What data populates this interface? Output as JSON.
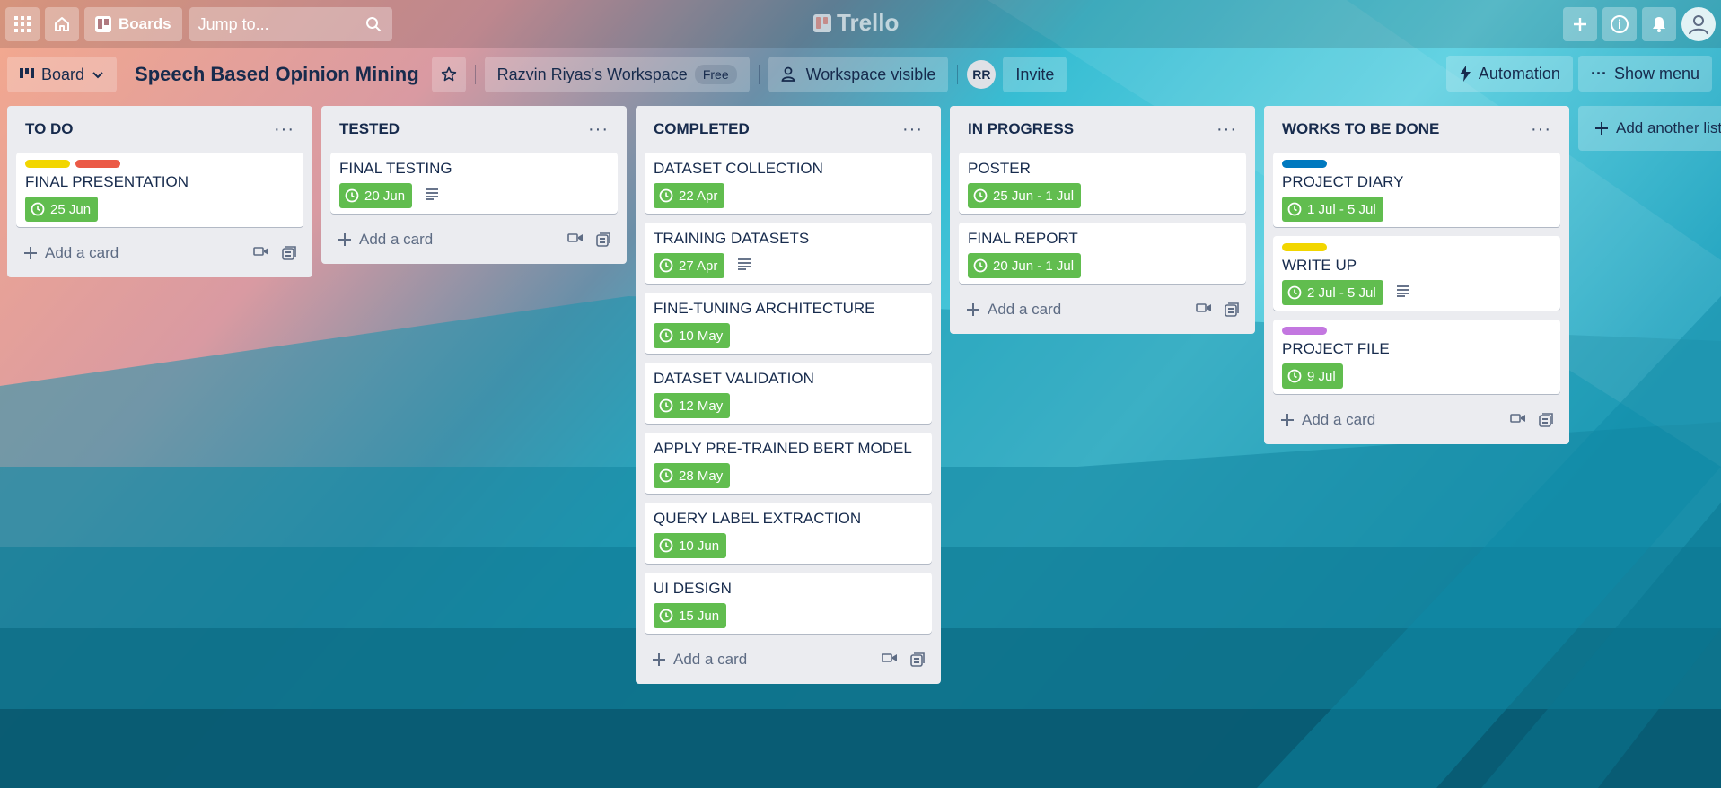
{
  "header": {
    "boards_label": "Boards",
    "search_placeholder": "Jump to...",
    "logo_text": "Trello"
  },
  "board": {
    "view_label": "Board",
    "title": "Speech Based Opinion Mining",
    "workspace_name": "Razvin Riyas's Workspace",
    "workspace_plan": "Free",
    "visibility_label": "Workspace visible",
    "member_initials": "RR",
    "invite_label": "Invite",
    "automation_label": "Automation",
    "show_menu_label": "Show menu"
  },
  "lists": [
    {
      "title": "TO DO",
      "add_label": "Add a card",
      "cards": [
        {
          "title": "FINAL PRESENTATION",
          "labels": [
            "#f2d600",
            "#eb5a46"
          ],
          "due": "25 Jun",
          "description": false
        }
      ]
    },
    {
      "title": "TESTED",
      "add_label": "Add a card",
      "cards": [
        {
          "title": "FINAL TESTING",
          "labels": [],
          "due": "20 Jun",
          "description": true
        }
      ]
    },
    {
      "title": "COMPLETED",
      "add_label": "Add a card",
      "cards": [
        {
          "title": "DATASET COLLECTION",
          "labels": [],
          "due": "22 Apr",
          "description": false
        },
        {
          "title": "TRAINING DATASETS",
          "labels": [],
          "due": "27 Apr",
          "description": true
        },
        {
          "title": "FINE-TUNING ARCHITECTURE",
          "labels": [],
          "due": "10 May",
          "description": false
        },
        {
          "title": "DATASET VALIDATION",
          "labels": [],
          "due": "12 May",
          "description": false
        },
        {
          "title": "APPLY PRE-TRAINED BERT MODEL",
          "labels": [],
          "due": "28 May",
          "description": false
        },
        {
          "title": "QUERY LABEL EXTRACTION",
          "labels": [],
          "due": "10 Jun",
          "description": false
        },
        {
          "title": "UI DESIGN",
          "labels": [],
          "due": "15 Jun",
          "description": false
        }
      ]
    },
    {
      "title": "IN PROGRESS",
      "add_label": "Add a card",
      "cards": [
        {
          "title": "POSTER",
          "labels": [],
          "due": "25 Jun - 1 Jul",
          "description": false
        },
        {
          "title": "FINAL REPORT",
          "labels": [],
          "due": "20 Jun - 1 Jul",
          "description": false
        }
      ]
    },
    {
      "title": "WORKS TO BE DONE",
      "add_label": "Add a card",
      "cards": [
        {
          "title": "PROJECT DIARY",
          "labels": [
            "#0079bf"
          ],
          "due": "1 Jul - 5 Jul",
          "description": false
        },
        {
          "title": "WRITE UP",
          "labels": [
            "#f2d600"
          ],
          "due": "2 Jul - 5 Jul",
          "description": true
        },
        {
          "title": "PROJECT FILE",
          "labels": [
            "#c377e0"
          ],
          "due": "9 Jul",
          "description": false
        }
      ]
    }
  ],
  "add_list_label": "Add another list"
}
